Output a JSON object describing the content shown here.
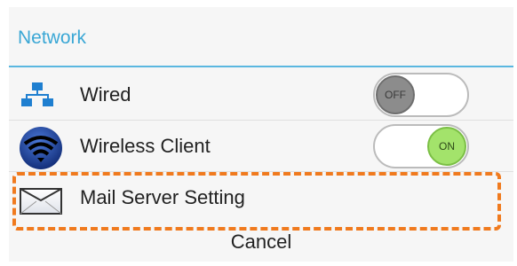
{
  "dialog": {
    "title": "Network",
    "accent_color": "#3aa7d5",
    "items": [
      {
        "label": "Wired",
        "icon": "network-icon",
        "toggle": {
          "state": "off",
          "text": "OFF"
        }
      },
      {
        "label": "Wireless Client",
        "icon": "wifi-icon",
        "toggle": {
          "state": "on",
          "text": "ON"
        }
      },
      {
        "label": "Mail Server Setting",
        "icon": "mail-icon"
      }
    ],
    "cancel_label": "Cancel"
  },
  "highlight_color": "#f07a1e",
  "toggle_on_color": "#a3e36b",
  "toggle_off_color": "#8c8c8c"
}
